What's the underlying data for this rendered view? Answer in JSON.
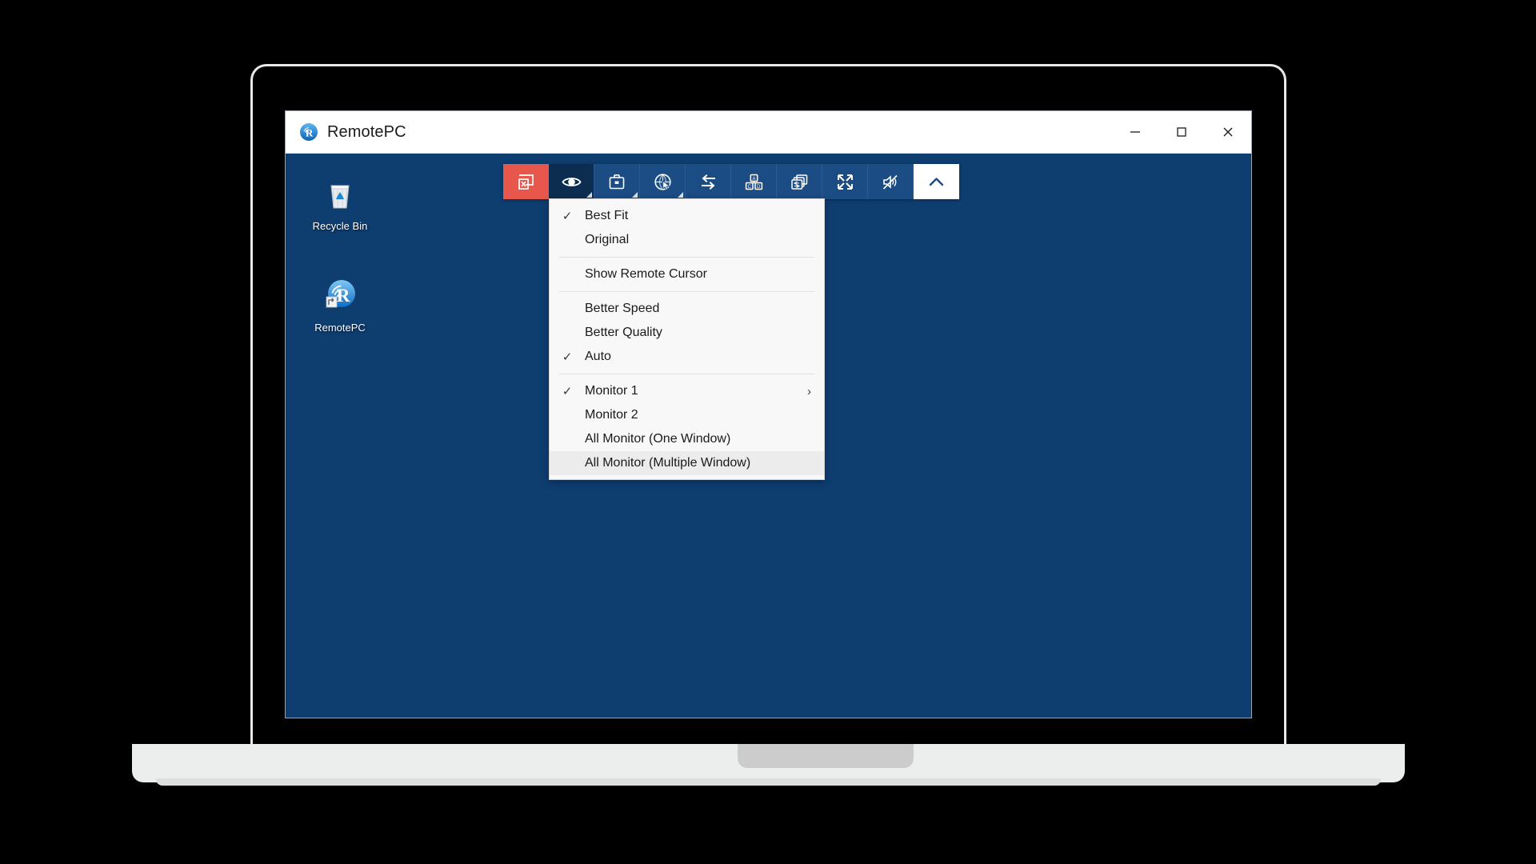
{
  "window": {
    "title": "RemotePC",
    "app_icon": "remotepc-logo-icon",
    "controls": {
      "minimize_label": "Minimize",
      "maximize_label": "Maximize",
      "close_label": "Close"
    }
  },
  "desktop": {
    "background_color": "#0e3d70",
    "icons": [
      {
        "name": "recycle-bin",
        "label": "Recycle Bin",
        "icon": "recycle-bin-icon"
      },
      {
        "name": "remotepc",
        "label": "RemotePC",
        "icon": "remotepc-shortcut-icon"
      }
    ]
  },
  "toolbar": {
    "background_color": "#1c4c84",
    "danger_color": "#e8574b",
    "buttons": [
      {
        "name": "disconnect",
        "icon": "disconnect-screen-icon",
        "tooltip": "Disconnect",
        "state": "danger",
        "has_caret": false
      },
      {
        "name": "view-options",
        "icon": "eye-icon",
        "tooltip": "View",
        "state": "active",
        "has_caret": true
      },
      {
        "name": "tools",
        "icon": "briefcase-icon",
        "tooltip": "Tools",
        "state": "normal",
        "has_caret": true
      },
      {
        "name": "remote-sound-cursor",
        "icon": "globe-cursor-icon",
        "tooltip": "Remote Settings",
        "state": "normal",
        "has_caret": true
      },
      {
        "name": "file-transfer",
        "icon": "transfer-arrows-icon",
        "tooltip": "File Transfer",
        "state": "normal",
        "has_caret": false
      },
      {
        "name": "keyboard-blocks",
        "icon": "abc-blocks-icon",
        "tooltip": "Send Keys",
        "state": "normal",
        "has_caret": false
      },
      {
        "name": "window-switch",
        "icon": "windows-stack-icon",
        "tooltip": "Switch Window",
        "state": "normal",
        "has_caret": false
      },
      {
        "name": "fullscreen",
        "icon": "expand-arrows-icon",
        "tooltip": "Full Screen",
        "state": "normal",
        "has_caret": false
      },
      {
        "name": "mute-sound",
        "icon": "speaker-muted-icon",
        "tooltip": "Mute",
        "state": "normal",
        "has_caret": false
      },
      {
        "name": "collapse-toolbar",
        "icon": "chevron-up-icon",
        "tooltip": "Collapse",
        "state": "light",
        "has_caret": false
      }
    ]
  },
  "view_menu": {
    "highlight_color": "#ececec",
    "check_glyph": "✓",
    "submenu_glyph": "›",
    "items": [
      {
        "name": "best-fit",
        "label": "Best Fit",
        "checked": true,
        "submenu": false,
        "highlighted": false,
        "separator_after": false
      },
      {
        "name": "original",
        "label": "Original",
        "checked": false,
        "submenu": false,
        "highlighted": false,
        "separator_after": true
      },
      {
        "name": "show-remote-cursor",
        "label": "Show Remote Cursor",
        "checked": false,
        "submenu": false,
        "highlighted": false,
        "separator_after": true
      },
      {
        "name": "better-speed",
        "label": "Better Speed",
        "checked": false,
        "submenu": false,
        "highlighted": false,
        "separator_after": false
      },
      {
        "name": "better-quality",
        "label": "Better Quality",
        "checked": false,
        "submenu": false,
        "highlighted": false,
        "separator_after": false
      },
      {
        "name": "auto",
        "label": "Auto",
        "checked": true,
        "submenu": false,
        "highlighted": false,
        "separator_after": true
      },
      {
        "name": "monitor-1",
        "label": "Monitor 1",
        "checked": true,
        "submenu": true,
        "highlighted": false,
        "separator_after": false
      },
      {
        "name": "monitor-2",
        "label": "Monitor 2",
        "checked": false,
        "submenu": false,
        "highlighted": false,
        "separator_after": false
      },
      {
        "name": "all-monitor-one-window",
        "label": "All Monitor (One Window)",
        "checked": false,
        "submenu": false,
        "highlighted": false,
        "separator_after": false
      },
      {
        "name": "all-monitor-multiple-window",
        "label": "All Monitor (Multiple Window)",
        "checked": false,
        "submenu": false,
        "highlighted": true,
        "separator_after": false
      }
    ]
  }
}
